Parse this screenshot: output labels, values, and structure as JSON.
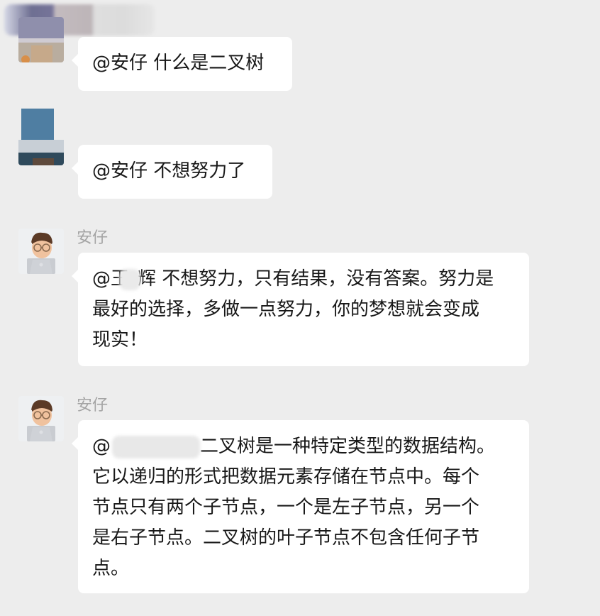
{
  "messages": [
    {
      "sender_name": "",
      "lines": [
        "@安仔 什么是二叉树"
      ],
      "avatar": "user-avatar-blurred"
    },
    {
      "sender_name": "",
      "lines": [
        "@安仔 不想努力了"
      ],
      "avatar": "user-avatar-blurred"
    },
    {
      "sender_name": "安仔",
      "lines": [
        {
          "prefix": "@王",
          "suffix": "辉 不想努力，只有结果，没有答案。努力是"
        },
        "最好的选择，多做一点努力，你的梦想就会变成",
        "现实！"
      ],
      "avatar": "memoji-laptop-avatar"
    },
    {
      "sender_name": "安仔",
      "lines": [
        {
          "prefix": "@",
          "suffix": "二叉树是一种特定类型的数据结构。"
        },
        "它以递归的形式把数据元素存储在节点中。每个",
        "节点只有两个子节点，一个是左子节点，另一个",
        "是右子节点。二叉树的叶子节点不包含任何子节",
        "点。"
      ],
      "avatar": "memoji-laptop-avatar"
    }
  ],
  "colors": {
    "background": "#ededed",
    "bubble": "#ffffff",
    "sender_name": "#a4a4a4",
    "text": "#181818"
  }
}
